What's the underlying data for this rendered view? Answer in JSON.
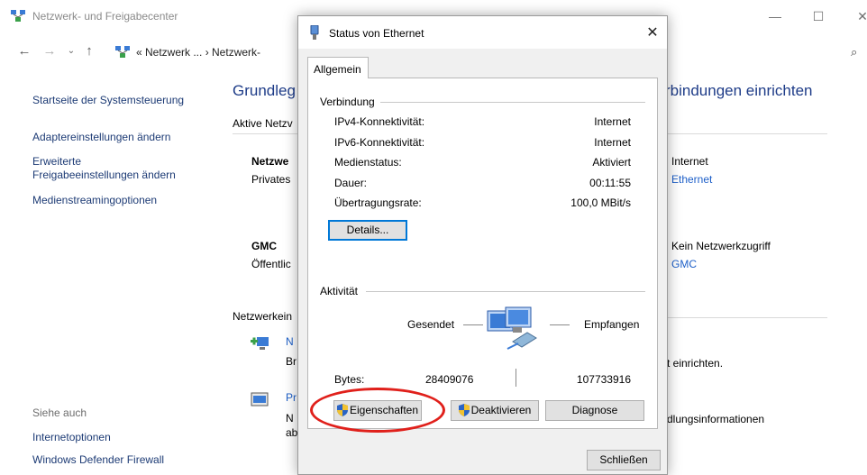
{
  "bg_window": {
    "title": "Netzwerk- und Freigabecenter",
    "minimize": "—",
    "maximize": "☐",
    "close": "✕",
    "address_path": "« Netzwerk ... › Netzwerk-",
    "left_nav": {
      "home": "Startseite der Systemsteuerung",
      "adapter": "Adaptereinstellungen ändern",
      "advanced_line1": "Erweiterte",
      "advanced_line2": "Freigabeeinstellungen ändern",
      "media": "Medienstreamingoptionen",
      "see_also": "Siehe auch",
      "internet_options": "Internetoptionen",
      "firewall": "Windows Defender Firewall"
    },
    "main": {
      "heading_left": "Grundleg",
      "heading_right": "rbindungen einrichten",
      "active_networks": "Aktive Netzv",
      "net1_name": "Netzwe",
      "net1_type": "Privates",
      "net1_access": "Internet",
      "net1_conn": "Ethernet",
      "net2_name": "GMC",
      "net2_type": "Öffentlic",
      "net2_access": "Kein Netzwerkzugriff",
      "net2_conn": "GMC",
      "change_settings": "Netzwerkein",
      "task1_title": "N",
      "task1_desc": "Br",
      "task1_desc_right": "t einrichten.",
      "task2_title": "Pr",
      "task2_desc1": "N",
      "task2_desc2": "ab",
      "task2_desc_right": "dlungsinformationen"
    }
  },
  "dialog": {
    "title": "Status von Ethernet",
    "close": "✕",
    "tab": "Allgemein",
    "connection_group": "Verbindung",
    "rows": [
      {
        "label": "IPv4-Konnektivität:",
        "value": "Internet"
      },
      {
        "label": "IPv6-Konnektivität:",
        "value": "Internet"
      },
      {
        "label": "Medienstatus:",
        "value": "Aktiviert"
      },
      {
        "label": "Dauer:",
        "value": "00:11:55"
      },
      {
        "label": "Übertragungsrate:",
        "value": "100,0 MBit/s"
      }
    ],
    "details_button": "Details...",
    "activity_group": "Aktivität",
    "sent_label": "Gesendet",
    "received_label": "Empfangen",
    "bytes_label": "Bytes:",
    "bytes_sent": "28409076",
    "bytes_received": "107733916",
    "properties_button": "Eigenschaften",
    "disable_button": "Deaktivieren",
    "diagnose_button": "Diagnose",
    "close_button": "Schließen"
  },
  "colors": {
    "link": "#1d3b75",
    "heading": "#1e3c88",
    "highlight_ellipse": "#e0201b",
    "shield_blue": "#2a64c5",
    "shield_yellow": "#f2c230"
  }
}
